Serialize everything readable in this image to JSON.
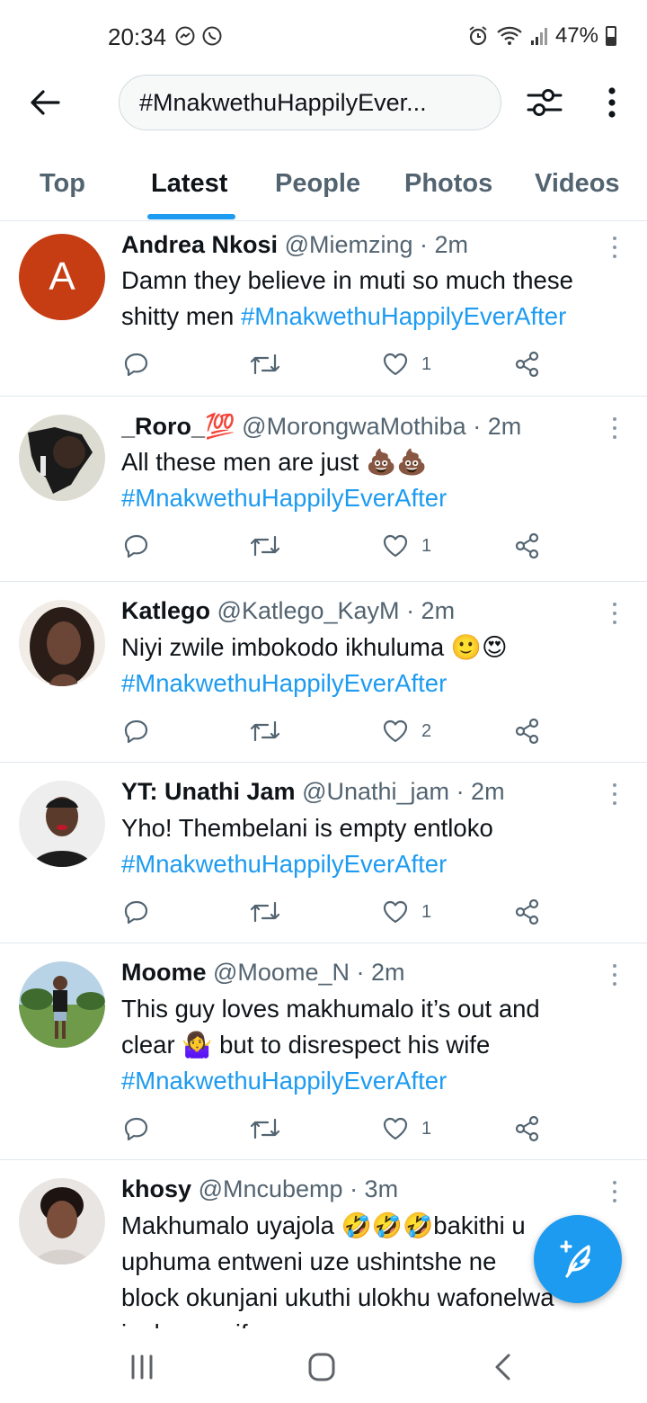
{
  "status_bar": {
    "time": "20:34",
    "battery": "47%"
  },
  "header": {
    "search_value": "#MnakwethuHappilyEver..."
  },
  "tabs": [
    {
      "label": "Top"
    },
    {
      "label": "Latest"
    },
    {
      "label": "People"
    },
    {
      "label": "Photos"
    },
    {
      "label": "Videos"
    }
  ],
  "tweets": [
    {
      "name": "Andrea Nkosi",
      "handle": "@Miemzing",
      "time": "· 2m",
      "avatar_letter": "A",
      "text_lines": [
        "Damn they believe in muti so much these",
        "shitty men "
      ],
      "hashtag": "#MnakwethuHappilyEverAfter",
      "likes": "1"
    },
    {
      "name": "_Roro_💯",
      "handle": "@MorongwaMothiba",
      "time": "· 2m",
      "text": "All these men are just 💩💩",
      "hashtag": "#MnakwethuHappilyEverAfter",
      "likes": "1"
    },
    {
      "name": "Katlego",
      "handle": "@Katlego_KayM",
      "time": "· 2m",
      "text": "Niyi zwile imbokodo ikhuluma 🙂😍",
      "hashtag": "#MnakwethuHappilyEverAfter",
      "likes": "2"
    },
    {
      "name": "YT: Unathi Jam",
      "handle": "@Unathi_jam",
      "time": "· 2m",
      "text": "Yho! Thembelani is empty entloko",
      "hashtag": "#MnakwethuHappilyEverAfter",
      "likes": "1"
    },
    {
      "name": "Moome",
      "handle": "@Moome_N",
      "time": "· 2m",
      "text_lines": [
        "This guy loves makhumalo it’s out and",
        "clear 🤷‍♀️ but to disrespect his wife"
      ],
      "hashtag": "#MnakwethuHappilyEverAfter",
      "likes": "1"
    },
    {
      "name": "khosy",
      "handle": "@Mncubemp",
      "time": "· 3m",
      "text_lines": [
        "Makhumalo uyajola 🤣🤣🤣bakithi u",
        "uphuma entweni uze ushintshe ne",
        "block okunjani ukuthi ulokhu wafonelwa",
        "i... k... a... if..."
      ]
    }
  ],
  "colors": {
    "accent": "#1d9bf0",
    "text": "#0f1419",
    "muted": "#536471",
    "avatar_a": "#c63c13"
  },
  "icons": [
    "back-arrow-icon",
    "filter-sliders-icon",
    "more-vertical-icon",
    "reply-icon",
    "retweet-icon",
    "like-heart-icon",
    "share-icon",
    "compose-tweet-icon"
  ]
}
